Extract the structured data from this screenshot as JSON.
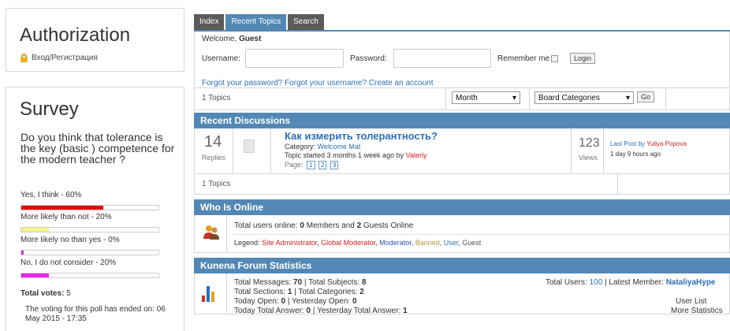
{
  "auth": {
    "title": "Authorization",
    "login_link": "Вход/Регистрация"
  },
  "survey": {
    "title": "Survey",
    "question": "Do you think that tolerance is the key (basic ) competence for the modern teacher ?",
    "options": [
      {
        "label": "Yes, I think - 60%",
        "percent": 60,
        "color": "#e60000"
      },
      {
        "label": "More likely than not - 20%",
        "percent": 20,
        "color": "#f5f58a"
      },
      {
        "label": "More likely no than yes - 0%",
        "percent": 0,
        "color": "#cc33cc"
      },
      {
        "label": "No, I do not consider - 20%",
        "percent": 20,
        "color": "#ee22ee"
      }
    ],
    "total_votes_label": "Total votes:",
    "total_votes": "5",
    "ended_text": "The voting for this poll has ended on: 06 May 2015 - 17:35"
  },
  "tabs": [
    "Index",
    "Recent Topics",
    "Search"
  ],
  "login": {
    "welcome_prefix": "Welcome,",
    "welcome_user": "Guest",
    "username_label": "Username:",
    "password_label": "Password:",
    "remember_label": "Remember me",
    "login_button": "Login",
    "forgot_links": "Forgot your password? Forgot your username? Create an account"
  },
  "filter": {
    "topics_count": "1 Topics",
    "period": "Month",
    "category": "Board Categories",
    "go": "Go"
  },
  "recent": {
    "header": "Recent Discussions",
    "replies": "14",
    "replies_label": "Replies",
    "title": "Как измерить толерантность?",
    "category_label": "Category:",
    "category": "Welcome Mat",
    "started": "Topic started 3 months 1 week ago by",
    "started_by": "Valeriy",
    "page_label": "Page:",
    "pages": [
      "1",
      "2",
      "3"
    ],
    "views": "123",
    "views_label": "Views",
    "last_post_label": "Last Post by",
    "last_post_user": "Yuliya Popova",
    "last_post_time": "1 day 9 hours ago",
    "footer_count": "1 Topics"
  },
  "online": {
    "header": "Who Is Online",
    "total_prefix": "Total users online:",
    "members": "0",
    "members_label": "Members and",
    "guests": "2",
    "guests_label": "Guests Online",
    "legend_label": "Legend:",
    "legend": [
      {
        "label": "Site Administrator",
        "color": "#cc2222"
      },
      {
        "label": "Global Moderator",
        "color": "#cc2222"
      },
      {
        "label": "Moderator",
        "color": "#2f4fb0"
      },
      {
        "label": "Banned",
        "color": "#b09a40"
      },
      {
        "label": "User",
        "color": "#2f6fb0"
      },
      {
        "label": "Guest",
        "color": "#555555"
      }
    ]
  },
  "stats": {
    "header": "Kunena Forum Statistics",
    "total_messages_label": "Total Messages:",
    "total_messages": "70",
    "total_subjects_label": "Total Subjects:",
    "total_subjects": "8",
    "total_sections_label": "Total Sections:",
    "total_sections": "1",
    "total_categories_label": "Total Categories:",
    "total_categories": "2",
    "today_open_label": "Today Open:",
    "today_open": "0",
    "yesterday_open_label": "Yesterday Open:",
    "yesterday_open": "0",
    "today_answer_label": "Today Total Answer:",
    "today_answer": "0",
    "yesterday_answer_label": "Yesterday Total Answer:",
    "yesterday_answer": "1",
    "total_users_label": "Total Users:",
    "total_users": "100",
    "latest_member_label": "Latest Member:",
    "latest_member": "NataliyaHype",
    "user_list": "User List",
    "more_stats": "More Statistics"
  }
}
